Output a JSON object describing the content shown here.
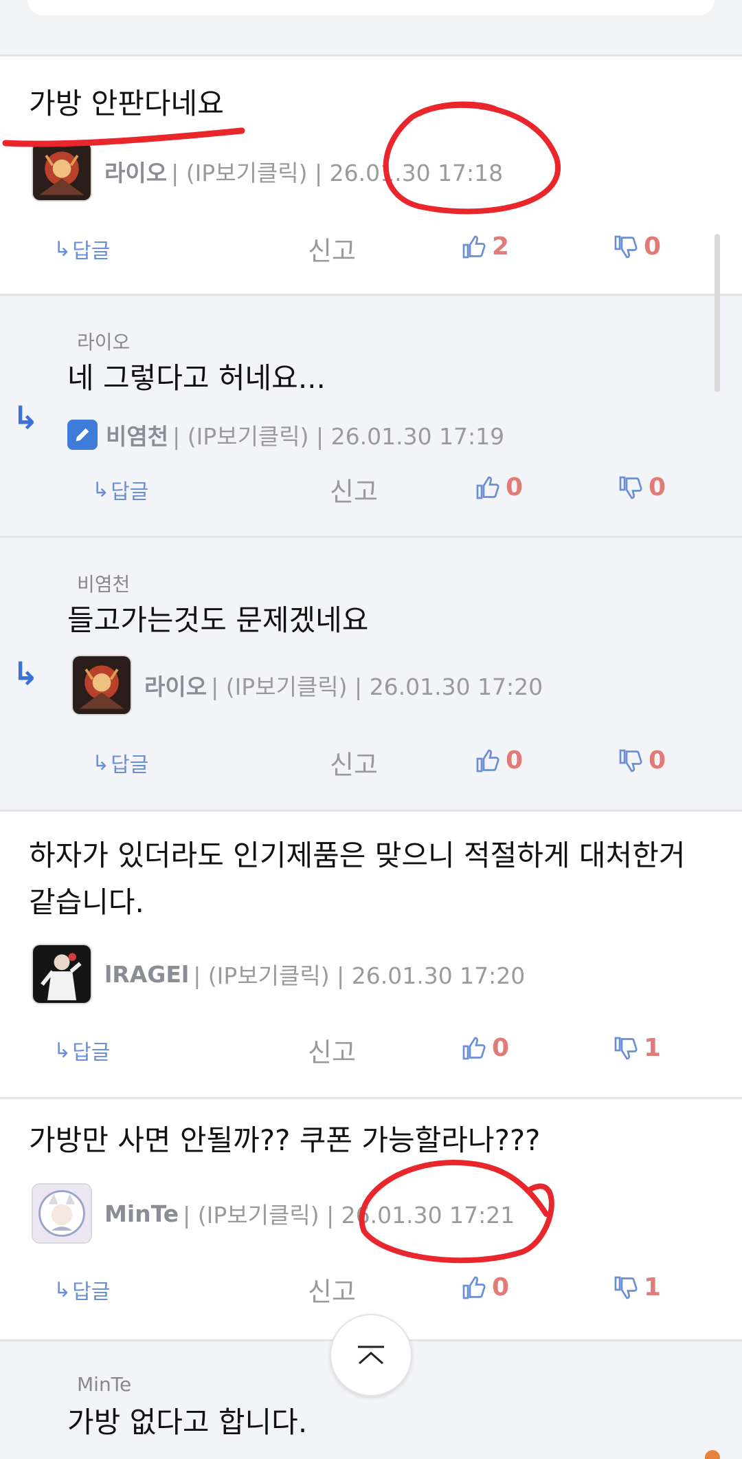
{
  "comments": [
    {
      "text": "가방 안판다네요",
      "author": "라이오",
      "meta": "| (IP보기클릭) | 26.01.30 17:18",
      "reply_label": "답글",
      "report_label": "신고",
      "likes": "2",
      "dislikes": "0"
    },
    {
      "parent": "라이오",
      "text": "네 그렇다고 허네요...",
      "author": "비염천",
      "meta": "| (IP보기클릭) | 26.01.30 17:19",
      "reply_label": "답글",
      "report_label": "신고",
      "likes": "0",
      "dislikes": "0"
    },
    {
      "parent": "비염천",
      "text": "들고가는것도 문제겠네요",
      "author": "라이오",
      "meta": "| (IP보기클릭) | 26.01.30 17:20",
      "reply_label": "답글",
      "report_label": "신고",
      "likes": "0",
      "dislikes": "0"
    },
    {
      "text_line1": "하자가 있더라도 인기제품은 맞으니 적절하게 대처한거",
      "text_line2": "같습니다.",
      "author": "lRAGEl",
      "meta": "| (IP보기클릭) | 26.01.30 17:20",
      "reply_label": "답글",
      "report_label": "신고",
      "likes": "0",
      "dislikes": "1"
    },
    {
      "text": "가방만 사면 안될까?? 쿠폰 가능할라나???",
      "author": "MinTe",
      "meta": "| (IP보기클릭) | 26.01.30 17:21",
      "reply_label": "답글",
      "report_label": "신고",
      "likes": "0",
      "dislikes": "1"
    },
    {
      "parent": "MinTe",
      "text": "가방 없다고 합니다."
    }
  ],
  "colors": {
    "reply_blue": "#3b72d6",
    "vote_red": "#e07b78",
    "annotation_red": "#e8262c"
  },
  "icons": {
    "reply": "reply-arrow-icon",
    "like": "thumbs-up-icon",
    "dislike": "thumbs-down-icon",
    "scroll_top": "chevron-up-icon",
    "edit": "pencil-icon"
  }
}
